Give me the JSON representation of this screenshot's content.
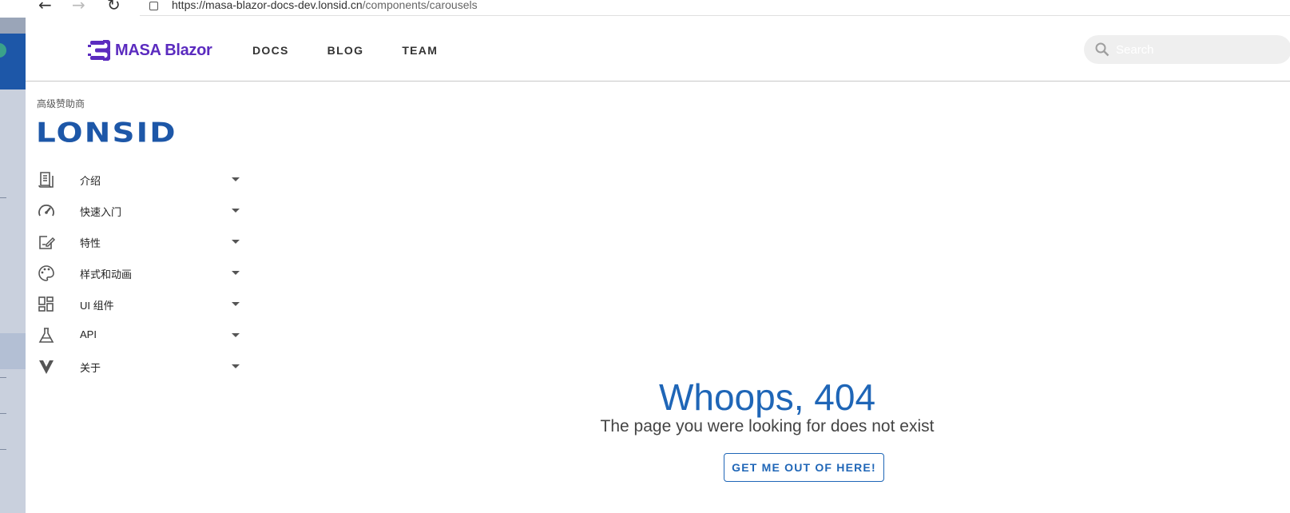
{
  "browser": {
    "back_glyph": "←",
    "forward_glyph": "→",
    "reload_glyph": "↻",
    "url_host": "https://masa-blazor-docs-dev.lonsid.cn",
    "url_path": "/components/carousels"
  },
  "header": {
    "logo_text": "MASA Blazor",
    "brand_color": "#5b2bbf",
    "nav": [
      "DOCS",
      "BLOG",
      "TEAM"
    ],
    "search_placeholder": "Search"
  },
  "sidebar": {
    "sponsor_label": "高级赞助商",
    "sponsor_logo_text": "LONSID",
    "items": [
      {
        "label": "介绍",
        "icon": "book-icon"
      },
      {
        "label": "快速入门",
        "icon": "speedometer-icon"
      },
      {
        "label": "特性",
        "icon": "edit-box-icon"
      },
      {
        "label": "样式和动画",
        "icon": "palette-icon"
      },
      {
        "label": "UI 组件",
        "icon": "dashboard-icon"
      },
      {
        "label": "API",
        "icon": "flask-icon"
      },
      {
        "label": "关于",
        "icon": "vuetify-icon"
      }
    ]
  },
  "main": {
    "error_title": "Whoops, 404",
    "error_subtitle": "The page you were looking for does not exist",
    "error_button": "GET ME OUT OF HERE!",
    "accent_color": "#1f66b7"
  }
}
